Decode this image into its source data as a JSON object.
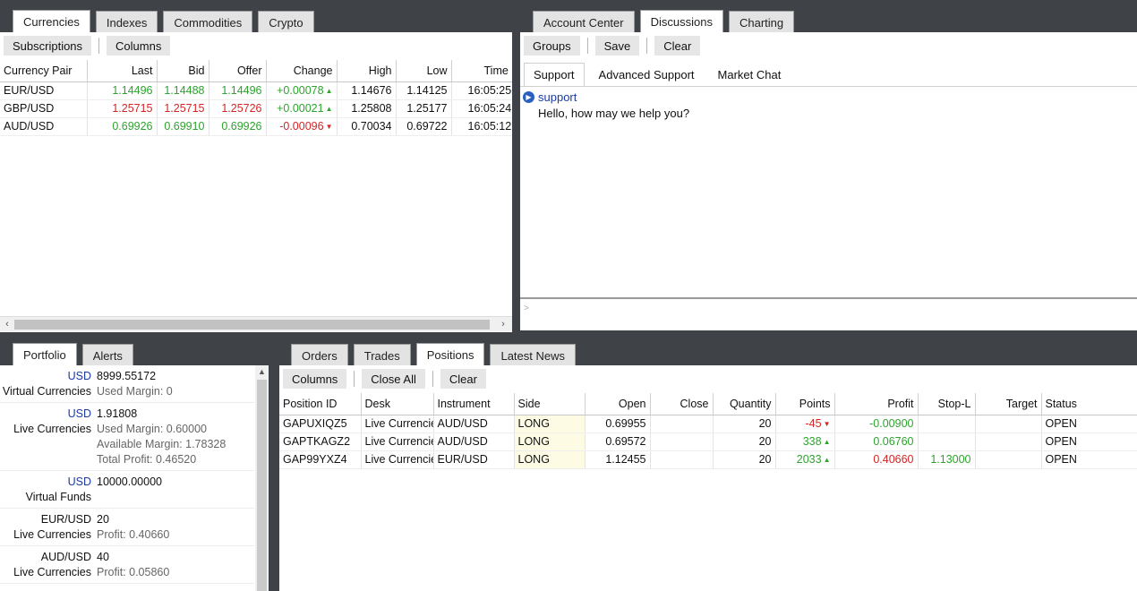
{
  "top_left": {
    "tabs": [
      "Currencies",
      "Indexes",
      "Commodities",
      "Crypto"
    ],
    "toolbar": [
      "Subscriptions",
      "Columns"
    ],
    "columns": [
      "Currency Pair",
      "Last",
      "Bid",
      "Offer",
      "Change",
      "High",
      "Low",
      "Time"
    ],
    "rows": [
      {
        "pair": "EUR/USD",
        "last": "1.14496",
        "bid": "1.14488",
        "offer": "1.14496",
        "change": "+0.00078",
        "high": "1.14676",
        "low": "1.14125",
        "time": "16:05:25"
      },
      {
        "pair": "GBP/USD",
        "last": "1.25715",
        "bid": "1.25715",
        "offer": "1.25726",
        "change": "+0.00021",
        "high": "1.25808",
        "low": "1.25177",
        "time": "16:05:24"
      },
      {
        "pair": "AUD/USD",
        "last": "0.69926",
        "bid": "0.69910",
        "offer": "0.69926",
        "change": "-0.00096",
        "high": "0.70034",
        "low": "0.69722",
        "time": "16:05:12"
      }
    ]
  },
  "top_right": {
    "tabs": [
      "Account Center",
      "Discussions",
      "Charting"
    ],
    "toolbar": [
      "Groups",
      "Save",
      "Clear"
    ],
    "subtabs": [
      "Support",
      "Advanced Support",
      "Market Chat"
    ],
    "message": {
      "sender": "support",
      "text": "Hello, how may we help you?"
    },
    "input_prompt": ">"
  },
  "bottom_left": {
    "tabs": [
      "Portfolio",
      "Alerts"
    ],
    "items": [
      {
        "cur": "USD",
        "value": "8999.55172",
        "label": "Virtual Currencies",
        "details": [
          "Used Margin:  0"
        ]
      },
      {
        "cur": "USD",
        "value": "1.91808",
        "label": "Live Currencies",
        "details": [
          "Used Margin:  0.60000",
          "Available Margin:  1.78328",
          "Total Profit:  0.46520"
        ]
      },
      {
        "cur": "USD",
        "value": "10000.00000",
        "label": "Virtual Funds",
        "details": []
      },
      {
        "cur": "EUR/USD",
        "value": "20",
        "label": "Live Currencies",
        "details": [
          "Profit:  0.40660"
        ]
      },
      {
        "cur": "AUD/USD",
        "value": "40",
        "label": "Live Currencies",
        "details": [
          "Profit:  0.05860"
        ]
      }
    ]
  },
  "bottom_right": {
    "tabs": [
      "Orders",
      "Trades",
      "Positions",
      "Latest News"
    ],
    "toolbar": [
      "Columns",
      "Close All",
      "Clear"
    ],
    "columns": [
      "Position ID",
      "Desk",
      "Instrument",
      "Side",
      "Open",
      "Close",
      "Quantity",
      "Points",
      "Profit",
      "Stop-L",
      "Target",
      "Status"
    ],
    "rows": [
      {
        "id": "GAPUXIQZ5",
        "desk": "Live Currencies",
        "instrument": "AUD/USD",
        "side": "LONG",
        "open": "0.69955",
        "close": "",
        "qty": "20",
        "points": "-45",
        "profit": "-0.00900",
        "stop": "",
        "target": "",
        "status": "OPEN"
      },
      {
        "id": "GAPTKAGZ2",
        "desk": "Live Currencies",
        "instrument": "AUD/USD",
        "side": "LONG",
        "open": "0.69572",
        "close": "",
        "qty": "20",
        "points": "338",
        "profit": "0.06760",
        "stop": "",
        "target": "",
        "status": "OPEN"
      },
      {
        "id": "GAP99YXZ4",
        "desk": "Live Currencies",
        "instrument": "EUR/USD",
        "side": "LONG",
        "open": "1.12455",
        "close": "",
        "qty": "20",
        "points": "2033",
        "profit": "0.40660",
        "stop": "1.13000",
        "target": "",
        "status": "OPEN"
      }
    ]
  },
  "colors": {
    "positive": "#2ea32e",
    "negative": "#d42525",
    "link_blue": "#1a3aa8"
  }
}
